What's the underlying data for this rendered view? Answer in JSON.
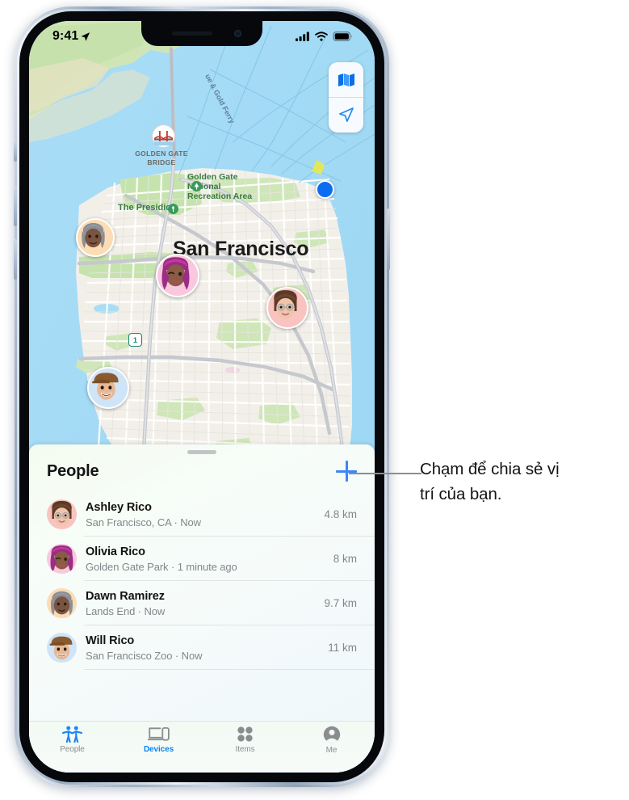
{
  "status_bar": {
    "time": "9:41",
    "location_arrow_icon": "location-arrow-icon",
    "cellular_icon": "cellular-bars-icon",
    "wifi_icon": "wifi-icon",
    "battery_icon": "battery-full-icon"
  },
  "map": {
    "controls": {
      "map_mode_icon": "map-icon",
      "locate_icon": "location-arrow-icon"
    },
    "labels": {
      "city": "San Francisco",
      "golden_gate_bridge": "GOLDEN GATE\nBRIDGE",
      "golden_gate_bridge_line1": "GOLDEN GATE",
      "golden_gate_bridge_line2": "BRIDGE",
      "national_rec_area_line1": "Golden Gate",
      "national_rec_area_line2": "National",
      "national_rec_area_line3": "Recreation Area",
      "presidio": "The Presidio",
      "ferry_route": "ue & Gold Ferry",
      "highway_shield": "1"
    },
    "pins": [
      {
        "name": "dawn-ramirez-pin",
        "bg": "#fbdcb4"
      },
      {
        "name": "olivia-rico-pin",
        "bg": "#f9c8de"
      },
      {
        "name": "ashley-rico-pin",
        "bg": "#f9c3c0"
      },
      {
        "name": "will-rico-pin",
        "bg": "#cfe4f7"
      }
    ],
    "user_location_dot": "current-location-dot",
    "user_dot_color": "#0b6df0"
  },
  "sheet": {
    "grabber": "sheet-grabber",
    "title": "People",
    "add_button_icon": "plus-icon",
    "accent_color": "#3b87f7",
    "people": [
      {
        "name": "Ashley Rico",
        "subtitle": "San Francisco, CA · Now",
        "distance": "4.8 km",
        "avatar_bg": "#f9c3c0"
      },
      {
        "name": "Olivia Rico",
        "subtitle": "Golden Gate Park · 1 minute ago",
        "distance": "8 km",
        "avatar_bg": "#f9c8de"
      },
      {
        "name": "Dawn Ramirez",
        "subtitle": "Lands End · Now",
        "distance": "9.7 km",
        "avatar_bg": "#fbdcb4"
      },
      {
        "name": "Will Rico",
        "subtitle": "San Francisco Zoo · Now",
        "distance": "11 km",
        "avatar_bg": "#cfe4f7"
      }
    ]
  },
  "tab_bar": {
    "active_label_color": "#0b84f3",
    "inactive_color": "#8a8d90",
    "tabs": [
      {
        "label": "People",
        "icon": "people-icon",
        "icon_active": true,
        "label_active": false
      },
      {
        "label": "Devices",
        "icon": "devices-icon",
        "icon_active": false,
        "label_active": true
      },
      {
        "label": "Items",
        "icon": "items-grid-icon",
        "icon_active": false,
        "label_active": false
      },
      {
        "label": "Me",
        "icon": "person-circle-icon",
        "icon_active": false,
        "label_active": false
      }
    ]
  },
  "callout": {
    "text_line1": "Chạm để chia sẻ vị",
    "text_line2": "trí của bạn.",
    "leader_line": "callout-leader-line"
  }
}
